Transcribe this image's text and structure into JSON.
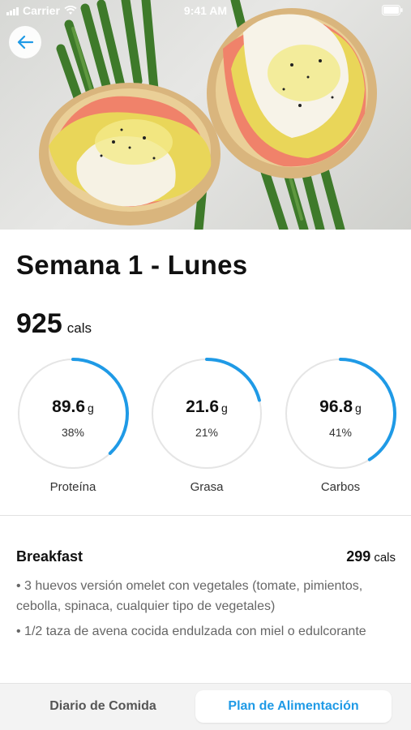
{
  "status_bar": {
    "carrier": "Carrier",
    "time": "9:41 AM"
  },
  "header": {
    "back_icon": "arrow-left-icon",
    "hero_image": "eggs-benedict-salmon-asparagus"
  },
  "title": "Semana 1 - Lunes",
  "total": {
    "value": "925",
    "unit": "cals"
  },
  "macros": [
    {
      "value": "89.6",
      "unit": "g",
      "percent": "38%",
      "label": "Proteína",
      "fraction": 0.38
    },
    {
      "value": "21.6",
      "unit": "g",
      "percent": "21%",
      "label": "Grasa",
      "fraction": 0.21
    },
    {
      "value": "96.8",
      "unit": "g",
      "percent": "41%",
      "label": "Carbos",
      "fraction": 0.41
    }
  ],
  "meal": {
    "name": "Breakfast",
    "cals": "299",
    "unit": "cals",
    "items": [
      "• 3 huevos versión omelet con vegetales (tomate, pimientos, cebolla, spinaca, cualquier tipo de vegetales)",
      "• 1/2 taza de avena cocida endulzada con miel o edulcorante"
    ]
  },
  "tabs": [
    {
      "label": "Diario de Comida",
      "active": false
    },
    {
      "label": "Plan de Alimentación",
      "active": true
    }
  ],
  "colors": {
    "accent": "#1f9ae6",
    "ring_track": "#e5e5e5"
  }
}
